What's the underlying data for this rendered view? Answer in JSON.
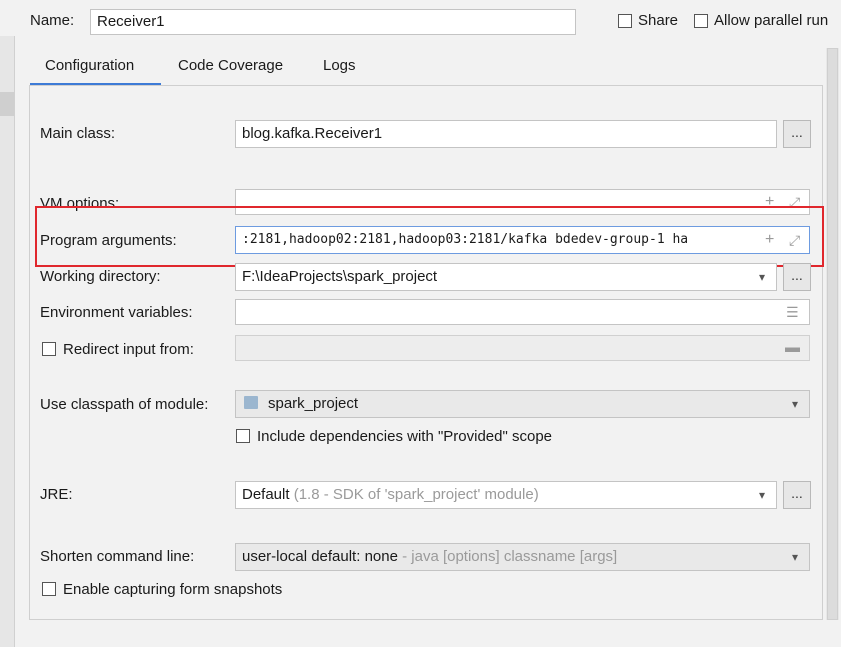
{
  "header": {
    "name_label": "Name:",
    "name_value": "Receiver1",
    "share_label": "Share",
    "parallel_label": "Allow parallel run"
  },
  "tabs": [
    {
      "label": "Configuration",
      "active": true
    },
    {
      "label": "Code Coverage",
      "active": false
    },
    {
      "label": "Logs",
      "active": false
    }
  ],
  "form": {
    "main_class_label": "Main class:",
    "main_class_value": "blog.kafka.Receiver1",
    "vm_options_label": "VM options:",
    "vm_options_value": "",
    "program_args_label": "Program arguments:",
    "program_args_value": ":2181,hadoop02:2181,hadoop03:2181/kafka bdedev-group-1 ha",
    "working_dir_label": "Working directory:",
    "working_dir_value": "F:\\IdeaProjects\\spark_project",
    "env_vars_label": "Environment variables:",
    "env_vars_value": "",
    "redirect_label": "Redirect input from:",
    "classpath_label": "Use classpath of module:",
    "classpath_value": "spark_project",
    "include_deps_label": "Include dependencies with \"Provided\" scope",
    "jre_label": "JRE:",
    "jre_value": "Default",
    "jre_hint": "(1.8 - SDK of 'spark_project' module)",
    "shorten_label": "Shorten command line:",
    "shorten_value": "user-local default: none",
    "shorten_hint": "- java [options] classname [args]",
    "snapshots_label": "Enable capturing form snapshots",
    "browse_label": "..."
  },
  "colors": {
    "highlight_frame": "#e0272d",
    "tab_accent": "#3d7bd6"
  }
}
